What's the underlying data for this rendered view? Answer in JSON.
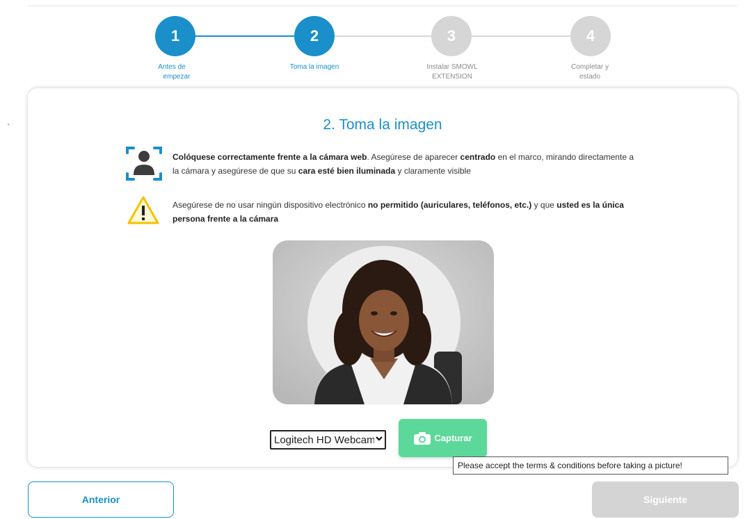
{
  "stepper": {
    "steps": [
      {
        "number": "1",
        "label_line1": "Antes de",
        "label_line2": "empezar",
        "state": "completed"
      },
      {
        "number": "2",
        "label_line1": "Toma la imagen",
        "label_line2": "",
        "state": "current"
      },
      {
        "number": "3",
        "label_line1": "Instalar SMOWL",
        "label_line2": "EXTENSION",
        "state": "pending"
      },
      {
        "number": "4",
        "label_line1": "Completar y",
        "label_line2": "estado",
        "state": "pending"
      }
    ]
  },
  "card": {
    "title": "2. Toma la imagen",
    "instruction1": {
      "icon": "face-frame-icon",
      "b1": "Colóquese correctamente frente a la cámara web",
      "t1": ". Asegúrese de aparecer ",
      "b2": "centrado",
      "t2": " en el marco, mirando directamente a la cámara y asegúrese de que su ",
      "b3": "cara esté bien iluminada",
      "t3": " y claramente visible"
    },
    "instruction2": {
      "icon": "warning-icon",
      "t1": "Asegúrese de no usar ningún dispositivo electrónico ",
      "b1": "no permitido (auriculares, teléfonos, etc.)",
      "t2": " y que ",
      "b2": "usted es la única persona frente a la cámara"
    },
    "camera_select": {
      "selected": "Logitech HD Webcam"
    },
    "capture_button": {
      "label": "Capturar",
      "icon": "camera-icon"
    },
    "tooltip": "Please accept the terms & conditions before taking a picture!"
  },
  "footer": {
    "prev_label": "Anterior",
    "next_label": "Siguiente"
  },
  "colors": {
    "accent": "#1a8fc9",
    "capture": "#5dd89b",
    "inactive": "#d6d6d6"
  }
}
